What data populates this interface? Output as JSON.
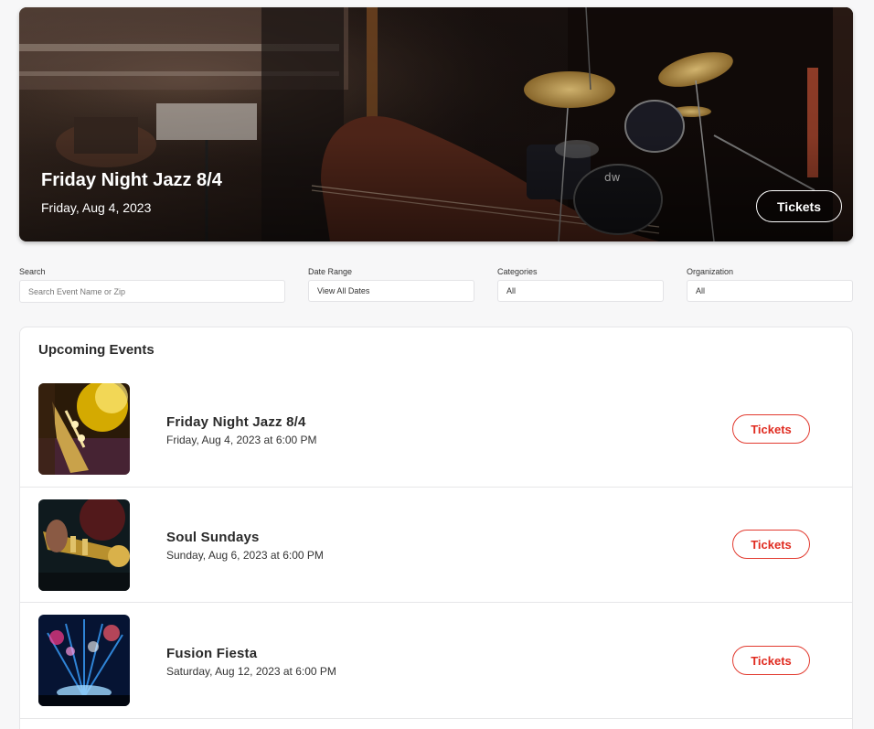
{
  "hero": {
    "title": "Friday Night Jazz 8/4",
    "date": "Friday, Aug 4, 2023",
    "tickets_label": "Tickets"
  },
  "filters": {
    "search": {
      "label": "Search",
      "placeholder": "Search Event Name or Zip"
    },
    "date_range": {
      "label": "Date Range",
      "value": "View All Dates"
    },
    "categories": {
      "label": "Categories",
      "value": "All"
    },
    "organization": {
      "label": "Organization",
      "value": "All"
    }
  },
  "events": {
    "heading": "Upcoming Events",
    "items": [
      {
        "name": "Friday Night Jazz 8/4",
        "date": "Friday, Aug 4, 2023 at 6:00 PM",
        "tickets_label": "Tickets"
      },
      {
        "name": "Soul Sundays",
        "date": "Sunday, Aug 6, 2023 at 6:00 PM",
        "tickets_label": "Tickets"
      },
      {
        "name": "Fusion Fiesta",
        "date": "Saturday, Aug 12, 2023 at 6:00 PM",
        "tickets_label": "Tickets"
      }
    ]
  },
  "colors": {
    "accent": "#e02b20",
    "background": "#f7f7f8"
  }
}
